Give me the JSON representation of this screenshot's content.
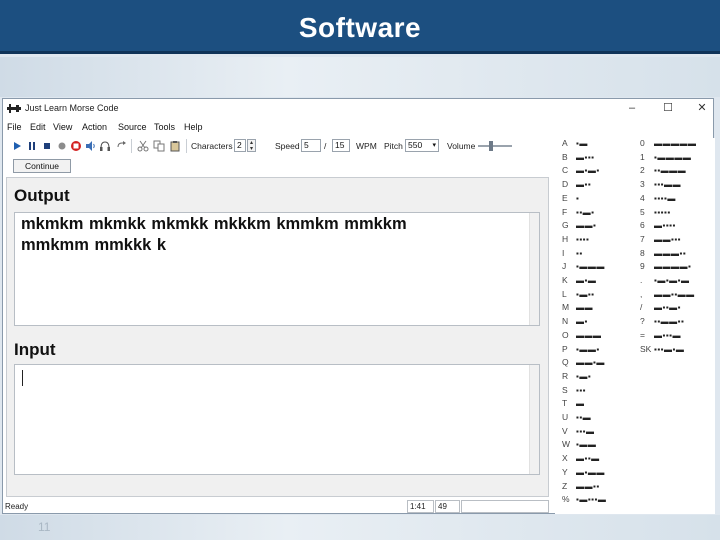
{
  "slide": {
    "title": "Software",
    "number": "11"
  },
  "window": {
    "title": "Just Learn Morse Code",
    "controls": {
      "minimize": "–",
      "maximize": "☐",
      "close": "✕"
    }
  },
  "menu": [
    "File",
    "Edit",
    "View",
    "Action",
    "Source",
    "Tools",
    "Help"
  ],
  "toolbar": {
    "characters_label": "Characters",
    "characters_value": "2",
    "speed_label": "Speed",
    "speed_value": "5",
    "speed_sep": "/",
    "wpm_value": "15",
    "wpm_label": "WPM",
    "pitch_label": "Pitch",
    "pitch_value": "550",
    "volume_label": "Volume",
    "volume_level": 0.35
  },
  "continue_button": "Continue",
  "output": {
    "heading": "Output",
    "text": "mkmkm mkmkk mkmkk mkkkm kmmkm mmkkm mmkmm mmkkk k"
  },
  "input": {
    "heading": "Input",
    "value": ""
  },
  "statusbar": {
    "text": "Ready",
    "time": "1:41",
    "count": "49"
  },
  "morse_chart": {
    "left_column": [
      {
        "char": "A",
        "code": "▪▬"
      },
      {
        "char": "B",
        "code": "▬▪▪▪"
      },
      {
        "char": "C",
        "code": "▬▪▬▪"
      },
      {
        "char": "D",
        "code": "▬▪▪"
      },
      {
        "char": "E",
        "code": "▪"
      },
      {
        "char": "F",
        "code": "▪▪▬▪"
      },
      {
        "char": "G",
        "code": "▬▬▪"
      },
      {
        "char": "H",
        "code": "▪▪▪▪"
      },
      {
        "char": "I",
        "code": "▪▪"
      },
      {
        "char": "J",
        "code": "▪▬▬▬"
      },
      {
        "char": "K",
        "code": "▬▪▬"
      },
      {
        "char": "L",
        "code": "▪▬▪▪"
      },
      {
        "char": "M",
        "code": "▬▬"
      },
      {
        "char": "N",
        "code": "▬▪"
      },
      {
        "char": "O",
        "code": "▬▬▬"
      },
      {
        "char": "P",
        "code": "▪▬▬▪"
      },
      {
        "char": "Q",
        "code": "▬▬▪▬"
      },
      {
        "char": "R",
        "code": "▪▬▪"
      },
      {
        "char": "S",
        "code": "▪▪▪"
      },
      {
        "char": "T",
        "code": "▬"
      },
      {
        "char": "U",
        "code": "▪▪▬"
      },
      {
        "char": "V",
        "code": "▪▪▪▬"
      },
      {
        "char": "W",
        "code": "▪▬▬"
      },
      {
        "char": "X",
        "code": "▬▪▪▬"
      },
      {
        "char": "Y",
        "code": "▬▪▬▬"
      },
      {
        "char": "Z",
        "code": "▬▬▪▪"
      },
      {
        "char": "%",
        "code": "▪▬▪▪▪▬"
      }
    ],
    "right_column": [
      {
        "char": "0",
        "code": "▬▬▬▬▬"
      },
      {
        "char": "1",
        "code": "▪▬▬▬▬"
      },
      {
        "char": "2",
        "code": "▪▪▬▬▬"
      },
      {
        "char": "3",
        "code": "▪▪▪▬▬"
      },
      {
        "char": "4",
        "code": "▪▪▪▪▬"
      },
      {
        "char": "5",
        "code": "▪▪▪▪▪"
      },
      {
        "char": "6",
        "code": "▬▪▪▪▪"
      },
      {
        "char": "7",
        "code": "▬▬▪▪▪"
      },
      {
        "char": "8",
        "code": "▬▬▬▪▪"
      },
      {
        "char": "9",
        "code": "▬▬▬▬▪"
      },
      {
        "char": ".",
        "code": "▪▬▪▬▪▬"
      },
      {
        "char": ",",
        "code": "▬▬▪▪▬▬"
      },
      {
        "char": "/",
        "code": "▬▪▪▬▪"
      },
      {
        "char": "?",
        "code": "▪▪▬▬▪▪"
      },
      {
        "char": "=",
        "code": "▬▪▪▪▬"
      },
      {
        "char": "SK",
        "code": "▪▪▪▬▪▬"
      }
    ]
  },
  "colors": {
    "header_bg": "#1c4f80",
    "window_bg": "#ffffff",
    "panel_bg": "#f0f0f0",
    "record_red": "#d32020",
    "play_blue": "#1f5fb0"
  },
  "icons": [
    "app-icon",
    "play-icon",
    "pause-icon",
    "stop-icon",
    "record-dot-icon",
    "record-icon",
    "speaker-icon",
    "loop-icon",
    "cut-icon",
    "copy-icon",
    "paste-icon"
  ]
}
